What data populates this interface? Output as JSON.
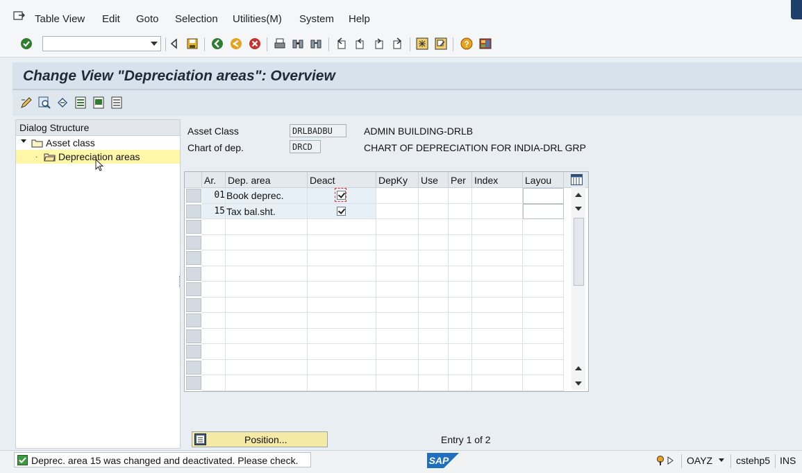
{
  "menubar": {
    "items": [
      "Table View",
      "Edit",
      "Goto",
      "Selection",
      "Utilities(M)",
      "System",
      "Help"
    ]
  },
  "toolbar": {
    "command_field_value": "",
    "icons": [
      "enter-icon",
      "back-icon",
      "save-icon",
      "exit-icon",
      "home-icon",
      "cancel-icon",
      "print-icon",
      "find-icon",
      "find-next-icon",
      "first-page-icon",
      "prev-page-icon",
      "next-page-icon",
      "last-page-icon",
      "create-session-icon",
      "shortcut-icon",
      "help-icon",
      "customize-layout-icon"
    ]
  },
  "title": "Change View \"Depreciation areas\": Overview",
  "app_toolbar": {
    "icons": [
      "edit-icon",
      "details-icon",
      "undo-icon",
      "select-all-icon",
      "select-block-icon",
      "deselect-all-icon"
    ]
  },
  "dialog_structure": {
    "header": "Dialog Structure",
    "items": [
      {
        "label": "Asset class",
        "expanded": true
      },
      {
        "label": "Depreciation areas",
        "selected": true
      }
    ]
  },
  "header_fields": {
    "asset_class": {
      "label": "Asset Class",
      "value": "DRLBADBU",
      "description": "ADMIN BUILDING-DRLB"
    },
    "chart_of_dep": {
      "label": "Chart of dep.",
      "value": "DRCD",
      "description": "CHART OF DEPRECIATION FOR INDIA-DRL GRP"
    }
  },
  "table": {
    "columns": [
      "Ar.",
      "Dep. area",
      "Deact",
      "DepKy",
      "Use",
      "Per",
      "Index",
      "Layou"
    ],
    "rows": [
      {
        "ar": "01",
        "dep_area": "Book deprec.",
        "deact": true,
        "depky": "",
        "use": "",
        "per": "",
        "index": "",
        "layout": ""
      },
      {
        "ar": "15",
        "dep_area": "Tax bal.sht.",
        "deact": true,
        "depky": "",
        "use": "",
        "per": "",
        "index": "",
        "layout": ""
      }
    ]
  },
  "position_button": "Position...",
  "entry_info": "Entry 1 of 2",
  "status": {
    "message": "Deprec. area 15 was changed and deactivated. Please check.",
    "logo": "SAP",
    "client": "OAYZ",
    "server": "cstehp5",
    "mode": "INS"
  },
  "colors": {
    "title_bg": "#d6e2ec",
    "selected_tree_item": "#fff7a8",
    "position_button_bg": "#f5e9a6",
    "sap_blue": "#1f6fbf"
  }
}
